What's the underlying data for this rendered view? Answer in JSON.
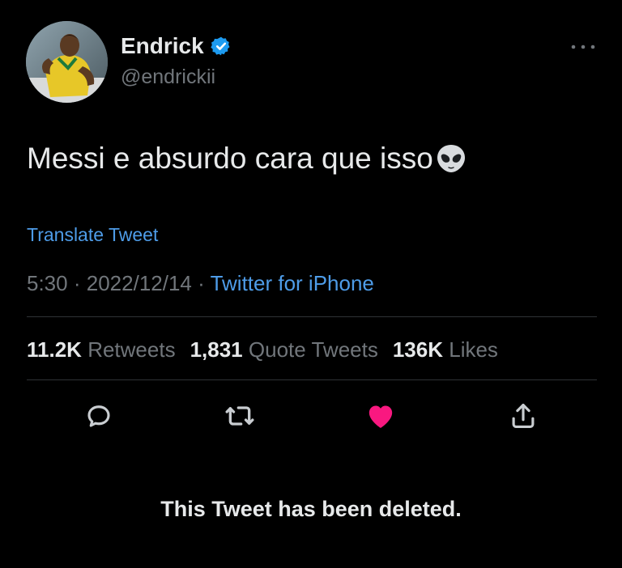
{
  "author": {
    "display_name": "Endrick",
    "handle": "@endrickii",
    "verified": true,
    "avatar": "avatar-photo-player-yellow-jersey"
  },
  "tweet": {
    "text": "Messi e absurdo cara que isso",
    "emoji": "alien-emoji",
    "translate_label": "Translate Tweet"
  },
  "meta": {
    "time": "5:30",
    "separator": "·",
    "date": "2022/12/14",
    "source": "Twitter for iPhone"
  },
  "stats": {
    "retweets_count": "11.2K",
    "retweets_label": "Retweets",
    "quote_count": "1,831",
    "quote_label": "Quote Tweets",
    "likes_count": "136K",
    "likes_label": "Likes"
  },
  "actions": {
    "reply_icon": "reply-icon",
    "retweet_icon": "retweet-icon",
    "like_icon": "heart-icon",
    "like_active": true,
    "share_icon": "share-icon"
  },
  "notice": {
    "deleted_text": "This Tweet has been deleted."
  },
  "colors": {
    "background": "#000000",
    "primary_text": "#e7e9ea",
    "secondary_text": "#71767b",
    "link": "#4e9ce8",
    "verified": "#1d9bf0",
    "like_active": "#f91880",
    "divider": "#2f3336"
  }
}
